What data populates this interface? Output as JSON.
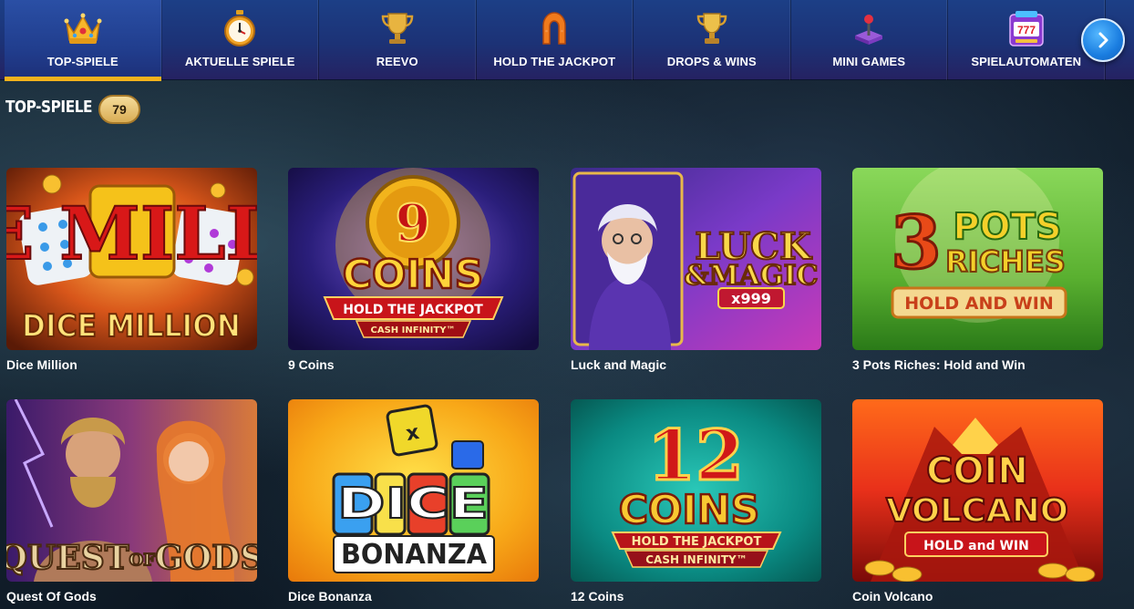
{
  "nav": {
    "items": [
      {
        "label": "TOP-SPIELE",
        "icon": "crown-icon",
        "active": true
      },
      {
        "label": "AKTUELLE SPIELE",
        "icon": "stopwatch-icon",
        "active": false
      },
      {
        "label": "REEVO",
        "icon": "trophy-icon",
        "active": false
      },
      {
        "label": "HOLD THE JACKPOT",
        "icon": "horseshoe-icon",
        "active": false
      },
      {
        "label": "DROPS & WINS",
        "icon": "trophy-cup-icon",
        "active": false
      },
      {
        "label": "MINI GAMES",
        "icon": "joystick-icon",
        "active": false
      },
      {
        "label": "SPIELAUTOMATEN",
        "icon": "slot-machine-icon",
        "active": false
      }
    ],
    "next_icon": "chevron-right-icon"
  },
  "section": {
    "title": "TOP-SPIELE",
    "count": "79"
  },
  "games": [
    {
      "title": "Dice Million",
      "art_text": [
        "DICE MILLION"
      ]
    },
    {
      "title": "9 Coins",
      "art_text": [
        "9",
        "COINS",
        "HOLD THE JACKPOT",
        "CASH INFINITY™"
      ]
    },
    {
      "title": "Luck and Magic",
      "art_text": [
        "LUCK",
        "&MAGIC",
        "x999"
      ]
    },
    {
      "title": "3 Pots Riches: Hold and Win",
      "art_text": [
        "3",
        "POTS",
        "RICHES",
        "HOLD AND WIN"
      ]
    },
    {
      "title": "Quest Of Gods",
      "art_text": [
        "QUEST",
        "OF",
        "GODS"
      ]
    },
    {
      "title": "Dice Bonanza",
      "art_text": [
        "DICE",
        "BONANZA"
      ]
    },
    {
      "title": "12 Coins",
      "art_text": [
        "12",
        "COINS",
        "HOLD THE JACKPOT",
        "CASH INFINITY™"
      ]
    },
    {
      "title": "Coin Volcano",
      "art_text": [
        "COIN",
        "VOLCANO",
        "HOLD and WIN"
      ]
    }
  ],
  "colors": {
    "accent": "#f3b21c",
    "nav_bg": "#1c3276",
    "badge": "#e8c274"
  }
}
